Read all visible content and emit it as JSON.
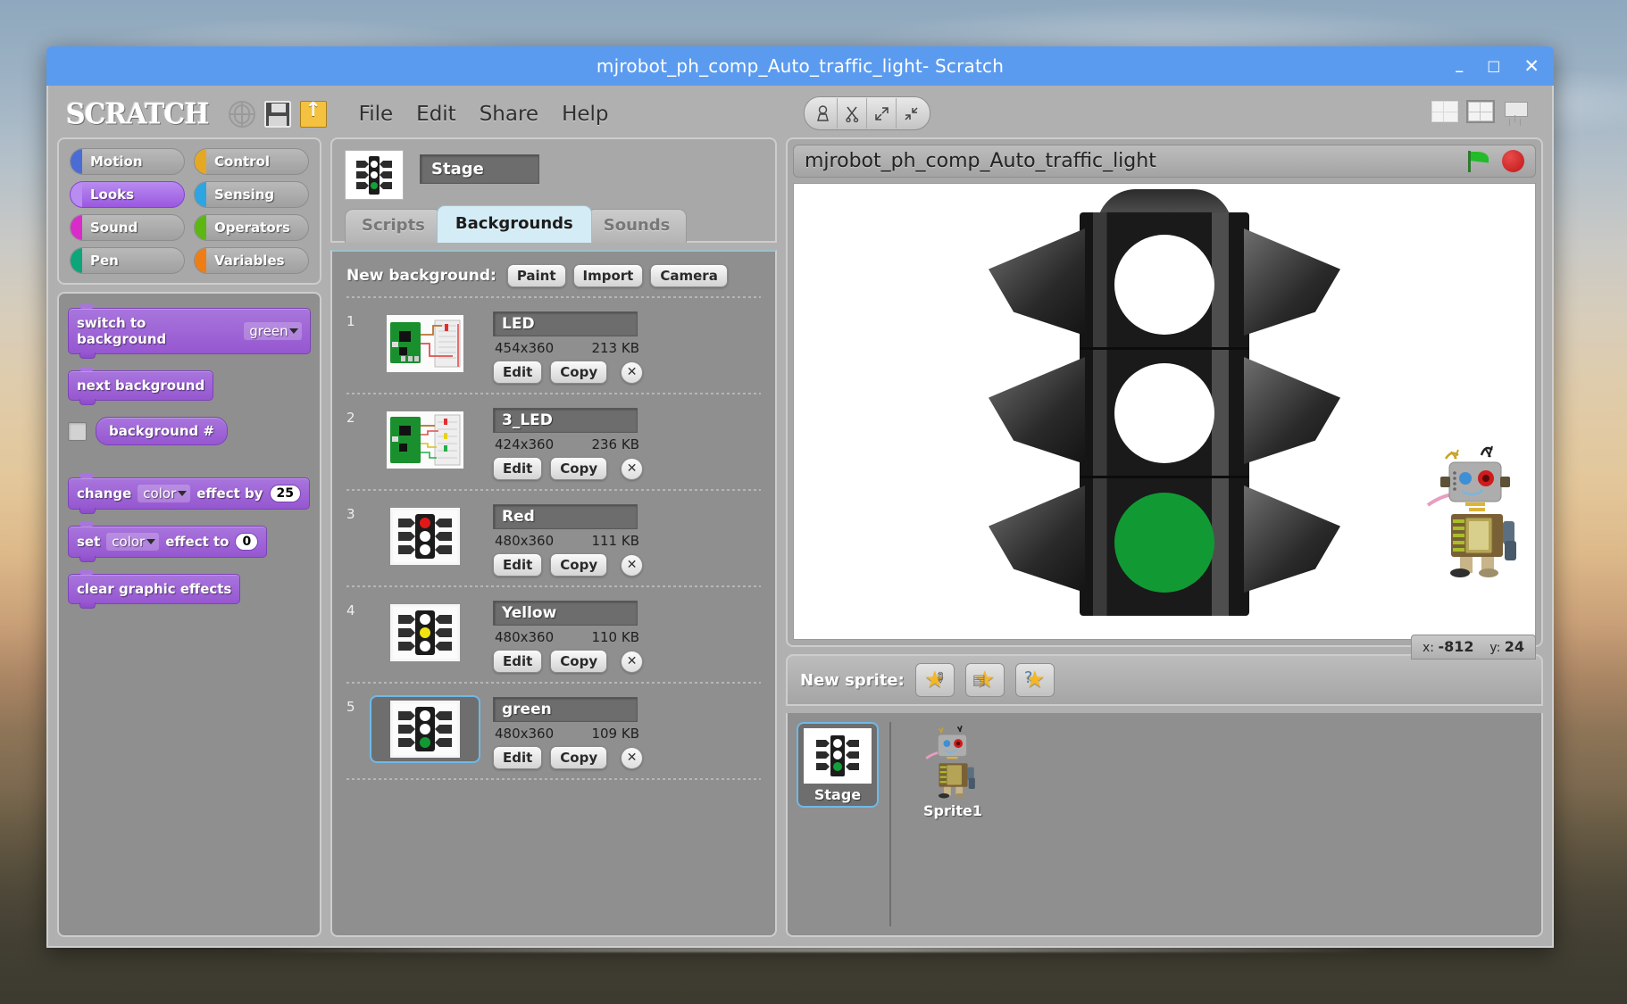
{
  "window": {
    "title": "mjrobot_ph_comp_Auto_traffic_light- Scratch",
    "minimize": "–",
    "maximize": "□",
    "close": "✕"
  },
  "menubar": {
    "logo": "SCRATCH",
    "icons": [
      "globe-icon",
      "save-icon",
      "share-icon"
    ],
    "items": [
      "File",
      "Edit",
      "Share",
      "Help"
    ],
    "tools": [
      "duplicate-stamp-icon",
      "delete-scissors-icon",
      "grow-icon",
      "shrink-icon"
    ],
    "view_modes": [
      "small-stage-layout",
      "normal-stage-layout",
      "presentation-mode"
    ]
  },
  "palette": {
    "categories": [
      {
        "label": "Motion",
        "color": "#4a6cd4",
        "active": false
      },
      {
        "label": "Control",
        "color": "#e6a822",
        "active": false
      },
      {
        "label": "Looks",
        "color": "#9b58e0",
        "active": true
      },
      {
        "label": "Sensing",
        "color": "#2ca5e2",
        "active": false
      },
      {
        "label": "Sound",
        "color": "#d92bc9",
        "active": false
      },
      {
        "label": "Operators",
        "color": "#5cb712",
        "active": false
      },
      {
        "label": "Pen",
        "color": "#0da57a",
        "active": false
      },
      {
        "label": "Variables",
        "color": "#ee7d16",
        "active": false
      }
    ],
    "blocks": [
      {
        "type": "stack",
        "prefix": "switch to background",
        "dropdown": "green",
        "suffix": ""
      },
      {
        "type": "stack",
        "prefix": "next background",
        "dropdown": "",
        "suffix": ""
      },
      {
        "type": "reporter",
        "prefix": "background #",
        "checkbox": true
      },
      {
        "type": "stack",
        "prefix": "change",
        "dropdown": "color",
        "suffix": "effect by",
        "value": "25"
      },
      {
        "type": "stack",
        "prefix": "set",
        "dropdown": "color",
        "suffix": "effect to",
        "value": "0"
      },
      {
        "type": "stack",
        "prefix": "clear graphic effects",
        "dropdown": "",
        "suffix": ""
      }
    ]
  },
  "center": {
    "stage_name": "Stage",
    "tabs": [
      {
        "label": "Scripts",
        "active": false
      },
      {
        "label": "Backgrounds",
        "active": true
      },
      {
        "label": "Sounds",
        "active": false
      }
    ],
    "new_background_label": "New background:",
    "new_background_buttons": [
      "Paint",
      "Import",
      "Camera"
    ],
    "edit_label": "Edit",
    "copy_label": "Copy",
    "delete_label": "✕",
    "backgrounds": [
      {
        "index": "1",
        "name": "LED",
        "dimensions": "454x360",
        "size": "213 KB",
        "thumb": "breadboard-1led",
        "selected": false
      },
      {
        "index": "2",
        "name": "3_LED",
        "dimensions": "424x360",
        "size": "236 KB",
        "thumb": "breadboard-3led",
        "selected": false
      },
      {
        "index": "3",
        "name": "Red",
        "dimensions": "480x360",
        "size": "111 KB",
        "thumb": "trafficlight-red",
        "selected": false
      },
      {
        "index": "4",
        "name": "Yellow",
        "dimensions": "480x360",
        "size": "110 KB",
        "thumb": "trafficlight-yellow",
        "selected": false
      },
      {
        "index": "5",
        "name": "green",
        "dimensions": "480x360",
        "size": "109 KB",
        "thumb": "trafficlight-green",
        "selected": true
      }
    ]
  },
  "stage": {
    "project_title": "mjrobot_ph_comp_Auto_traffic_light",
    "green_flag": "green-flag-icon",
    "stop": "stop-sign-icon",
    "lights": {
      "top": "#ffffff",
      "middle": "#ffffff",
      "bottom": "#119a34"
    },
    "mouse_x_label": "x:",
    "mouse_x": "-812",
    "mouse_y_label": "y:",
    "mouse_y": "24"
  },
  "sprites": {
    "new_sprite_label": "New sprite:",
    "new_sprite_buttons": [
      "paint-new-sprite",
      "import-sprite-from-file",
      "random-sprite"
    ],
    "stage_tile_label": "Stage",
    "items": [
      {
        "name": "Sprite1",
        "selected": false
      }
    ]
  },
  "colors": {
    "titlebar": "#5b9bef",
    "accent_selected": "#6fb9e8",
    "looks_purple": "#9b58e0",
    "green_light": "#119a34",
    "yellow_light": "#f2e313",
    "red_light": "#d81e1e"
  }
}
